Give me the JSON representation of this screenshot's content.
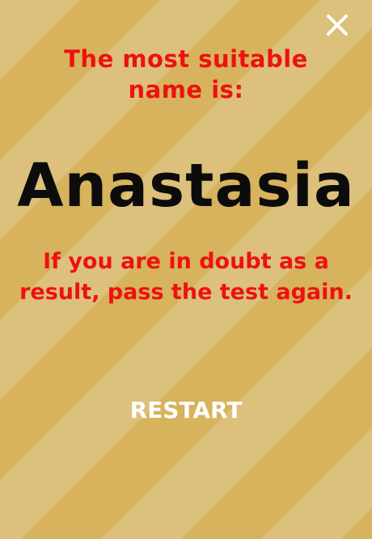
{
  "header": {
    "close_icon": "close-icon"
  },
  "result": {
    "title": "The most suitable name is:",
    "name": "Anastasia",
    "doubt_text": "If you are in doubt as a result, pass the test again."
  },
  "actions": {
    "restart_label": "RESTART"
  },
  "colors": {
    "title_text": "#ee1111",
    "name_text": "#0c0c0c",
    "button_text": "#ffffff",
    "stripe_light": "#dcc07b",
    "stripe_dark": "#d6b35c"
  }
}
